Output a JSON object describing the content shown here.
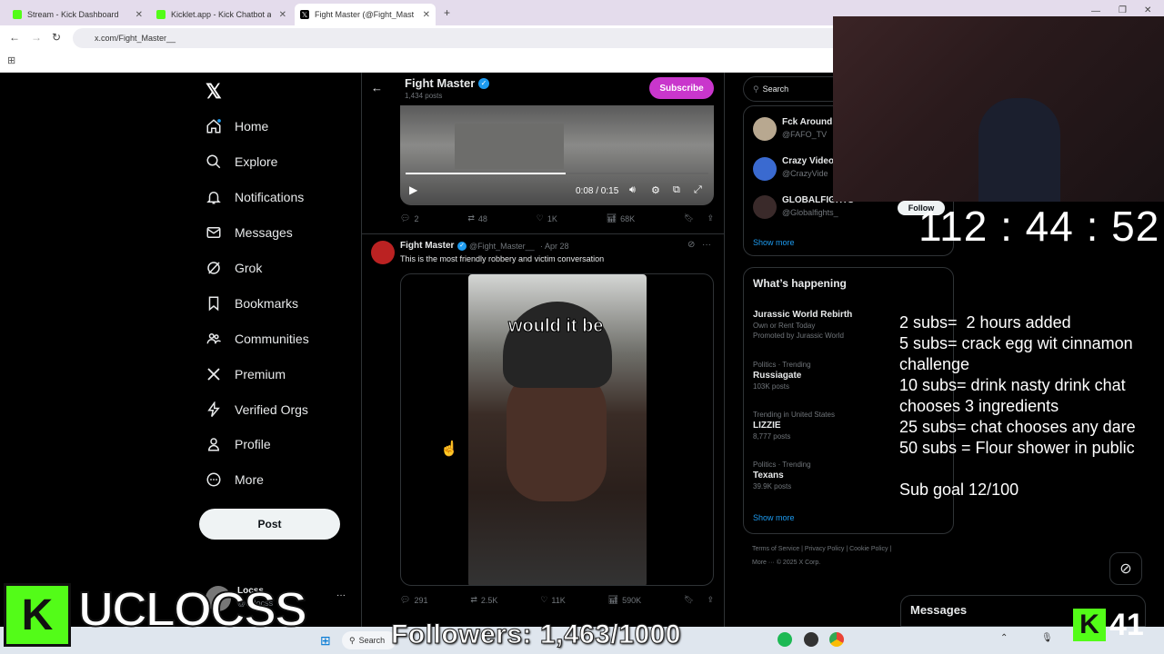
{
  "browser": {
    "tabs": [
      {
        "label": "Stream - Kick Dashboard",
        "color": "#53fc18"
      },
      {
        "label": "Kicklet.app - Kick Chatbot and",
        "color": "#53fc18"
      },
      {
        "label": "Fight Master (@Fight_Mast",
        "color": "#000000"
      }
    ],
    "url": "x.com/Fight_Master__"
  },
  "nav": {
    "items": [
      {
        "label": "Home",
        "icon": "home-icon"
      },
      {
        "label": "Explore",
        "icon": "search-icon"
      },
      {
        "label": "Notifications",
        "icon": "bell-icon"
      },
      {
        "label": "Messages",
        "icon": "mail-icon"
      },
      {
        "label": "Grok",
        "icon": "grok-icon"
      },
      {
        "label": "Bookmarks",
        "icon": "bookmark-icon"
      },
      {
        "label": "Communities",
        "icon": "people-icon"
      },
      {
        "label": "Premium",
        "icon": "x-icon"
      },
      {
        "label": "Verified Orgs",
        "icon": "bolt-icon"
      },
      {
        "label": "Profile",
        "icon": "person-icon"
      },
      {
        "label": "More",
        "icon": "more-icon"
      }
    ],
    "post_label": "Post",
    "account_name": "Locss",
    "account_handle": "@uclocss"
  },
  "header": {
    "title": "Fight Master",
    "posts_count": "1,434 posts",
    "subscribe_label": "Subscribe"
  },
  "video1": {
    "time": "0:08 / 0:15",
    "progress": 0.53
  },
  "post1_stats": {
    "replies": "2",
    "reposts": "48",
    "likes": "1K",
    "views": "68K"
  },
  "post2": {
    "author": "Fight Master",
    "handle": "@Fight_Master__",
    "date": "· Apr 28",
    "text": "This is the most friendly robbery and victim conversation",
    "caption": "would it be",
    "stats": {
      "replies": "291",
      "reposts": "2.5K",
      "likes": "11K",
      "views": "590K"
    }
  },
  "sidebar": {
    "search_placeholder": "Search",
    "who_to_follow": [
      {
        "name": "Fck Around",
        "handle": "@FAFO_TV"
      },
      {
        "name": "Crazy Video",
        "handle": "@CrazyVide"
      },
      {
        "name": "GLOBALFIGHTS",
        "handle": "@Globalfights_"
      }
    ],
    "follow_label": "Follow",
    "show_more": "Show more",
    "happening_title": "What’s happening",
    "trends": [
      {
        "name": "Jurassic World Rebirth",
        "sub": "Own or Rent Today",
        "promo": "Promoted by Jurassic World"
      },
      {
        "cat": "Politics · Trending",
        "name": "Russiagate",
        "count": "103K posts"
      },
      {
        "cat": "Trending in United States",
        "name": "LIZZIE",
        "count": "8,777 posts"
      },
      {
        "cat": "Politics · Trending",
        "name": "Texans",
        "count": "39.9K posts"
      }
    ],
    "show_more_2": "Show more",
    "footer1": "Terms of Service | Privacy Policy | Cookie Policy |",
    "footer2": "More ··· © 2025 X Corp."
  },
  "messages_label": "Messages",
  "overlay": {
    "timer": "112 : 44 : 52",
    "goals": "2 subs=  2 hours added\n5 subs= crack egg wit cinnamon\nchallenge\n10 subs= drink nasty drink chat\nchooses 3 ingredients\n25 subs= chat chooses any dare\n50 subs = Flour shower in public\n\nSub goal 12/100",
    "followers": "Followers: 1,463/1000",
    "channel": "UCLOCSS",
    "kick_letter": "K",
    "sub_count": "41"
  },
  "taskbar": {
    "search_label": "Search"
  }
}
